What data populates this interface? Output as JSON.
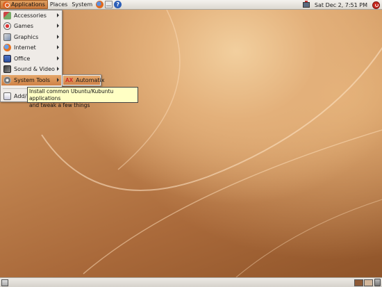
{
  "top_panel": {
    "menus": [
      {
        "label": "Applications"
      },
      {
        "label": "Places"
      },
      {
        "label": "System"
      }
    ],
    "launchers": [
      "firefox-icon",
      "mail-icon",
      "help-icon"
    ],
    "clock": "Sat Dec  2,  7:51 PM"
  },
  "applications_menu": {
    "items": [
      {
        "label": "Accessories",
        "icon": "accessories-icon"
      },
      {
        "label": "Games",
        "icon": "games-icon"
      },
      {
        "label": "Graphics",
        "icon": "graphics-icon"
      },
      {
        "label": "Internet",
        "icon": "internet-icon"
      },
      {
        "label": "Office",
        "icon": "office-icon"
      },
      {
        "label": "Sound & Video",
        "icon": "sound-video-icon"
      },
      {
        "label": "System Tools",
        "icon": "system-tools-icon"
      }
    ],
    "add_remove_label": "Add/R"
  },
  "system_tools_submenu": {
    "items": [
      {
        "label": "Automatix",
        "icon": "automatix-icon",
        "icon_text": "AX"
      }
    ]
  },
  "tooltip": {
    "line1": "Install common Ubuntu/Kubuntu applications",
    "line2": "and tweak a few things"
  },
  "colors": {
    "menu_highlight": "#cf8146",
    "wallpaper": "#b97e4e",
    "tooltip_bg": "#ffffc4"
  }
}
